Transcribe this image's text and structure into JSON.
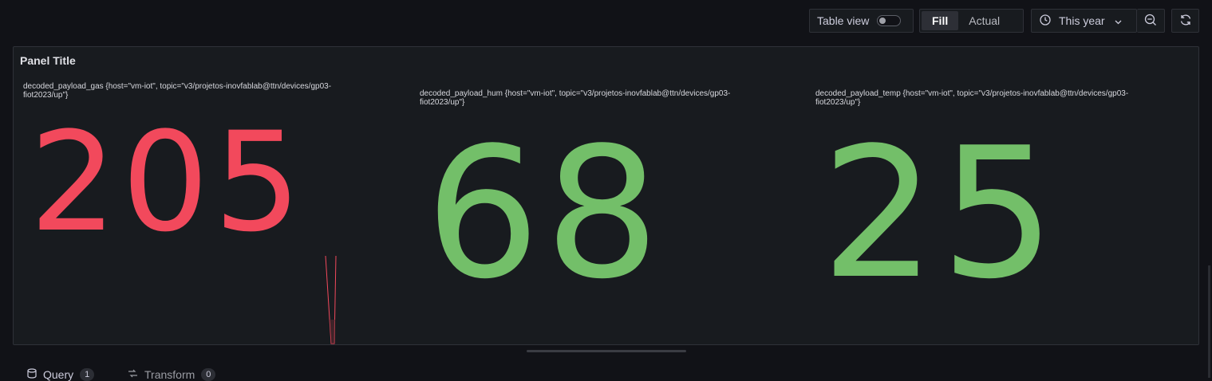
{
  "colors": {
    "background": "#111217",
    "panel_background": "#181b1f",
    "red_threshold": "#f2495c",
    "green_threshold": "#73bf69"
  },
  "toolbar": {
    "table_view_label": "Table view",
    "table_view_enabled": false,
    "fill_label": "Fill",
    "actual_label": "Actual",
    "active_mode": "Fill",
    "time_range_icon": "clock-icon",
    "time_range_label": "This year",
    "zoom_out_icon": "zoom-out-icon",
    "refresh_icon": "refresh-icon"
  },
  "panel": {
    "title": "Panel Title",
    "stats": [
      {
        "name": "decoded_payload_gas {host=\"vm-iot\", topic=\"v3/projetos-inovfablab@ttn/devices/gp03-fiot2023/up\"}",
        "value": "205",
        "color": "#f2495c"
      },
      {
        "name": "decoded_payload_hum {host=\"vm-iot\", topic=\"v3/projetos-inovfablab@ttn/devices/gp03-fiot2023/up\"}",
        "value": "68",
        "color": "#73bf69"
      },
      {
        "name": "decoded_payload_temp {host=\"vm-iot\", topic=\"v3/projetos-inovfablab@ttn/devices/gp03-fiot2023/up\"}",
        "value": "25",
        "color": "#73bf69"
      }
    ]
  },
  "tabs": [
    {
      "label": "Query",
      "count": "1",
      "icon": "database-icon"
    },
    {
      "label": "Transform",
      "count": "0",
      "icon": "transform-icon"
    }
  ]
}
